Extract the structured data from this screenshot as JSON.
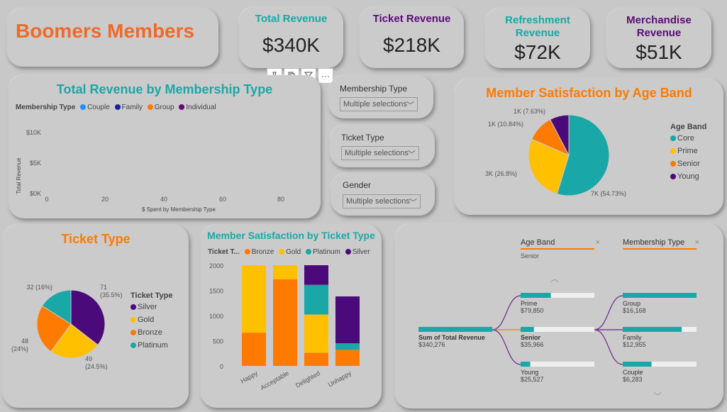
{
  "title": "Boomers Members",
  "kpis": [
    {
      "label": "Total Revenue",
      "value": "$340K",
      "color": "#1aa7a7"
    },
    {
      "label": "Ticket Revenue",
      "value": "$218K",
      "color": "#5b0a7a"
    },
    {
      "label": "Refreshment Revenue",
      "value": "$72K",
      "color": "#1aa7a7"
    },
    {
      "label": "Merchandise Revenue",
      "value": "$51K",
      "color": "#5b0a7a"
    }
  ],
  "toolbar": {
    "more": "···"
  },
  "colors": {
    "teal": "#1aa7a7",
    "purple": "#4b0a7a",
    "orange": "#ff7a00",
    "gold": "#ffc000",
    "title_orange": "#ee6a2a",
    "blue_light": "#1e90ff",
    "navy": "#12239e",
    "violet": "#6b007b"
  },
  "slicers": [
    {
      "label": "Membership Type",
      "value": "Multiple selections"
    },
    {
      "label": "Ticket Type",
      "value": "Multiple selections"
    },
    {
      "label": "Gender",
      "value": "Multiple selections"
    }
  ],
  "revenue_by_membership": {
    "title": "Total Revenue by Membership Type",
    "legend_title": "Membership Type",
    "legend": [
      "Couple",
      "Family",
      "Group",
      "Individual"
    ],
    "ylabel": "Total Revenue",
    "xlabel": "$ Spent by Membership Type",
    "yticks": [
      "$10K",
      "$5K",
      "$0K"
    ],
    "xticks": [
      "0",
      "20",
      "40",
      "60",
      "80"
    ]
  },
  "chart_data": [
    {
      "type": "pie",
      "title": "Member Satisfaction by Age Band",
      "legend_title": "Age Band",
      "labels": [
        "Core",
        "Prime",
        "Senior",
        "Young"
      ],
      "values": [
        54.73,
        26.8,
        10.84,
        7.63
      ],
      "data_labels": [
        "7K (54.73%)",
        "3K (26.8%)",
        "1K (10.84%)",
        "1K (7.63%)"
      ],
      "colors": [
        "#1aa7a7",
        "#ffc000",
        "#ff7a00",
        "#4b0a7a"
      ]
    },
    {
      "type": "pie",
      "title": "Ticket Type",
      "legend_title": "Ticket Type",
      "labels": [
        "Silver",
        "Gold",
        "Bronze",
        "Platinum"
      ],
      "values": [
        71,
        49,
        48,
        32
      ],
      "data_labels": [
        "71\n(35.5%)",
        "49\n(24.5%)",
        "48\n(24%)",
        "32 (16%)"
      ],
      "colors": [
        "#4b0a7a",
        "#ffc000",
        "#ff7a00",
        "#1aa7a7"
      ]
    },
    {
      "type": "bar",
      "stacked": true,
      "title": "Member Satisfaction by Ticket Type",
      "legend_title": "Ticket T...",
      "categories": [
        "Happy",
        "Acceptable",
        "Delighted",
        "Unhappy"
      ],
      "series": [
        {
          "name": "Bronze",
          "values": [
            660,
            1720,
            260,
            320
          ],
          "color": "#ff7a00"
        },
        {
          "name": "Gold",
          "values": [
            1340,
            280,
            760,
            0
          ],
          "color": "#ffc000"
        },
        {
          "name": "Platinum",
          "values": [
            0,
            0,
            590,
            130
          ],
          "color": "#1aa7a7"
        },
        {
          "name": "Silver",
          "values": [
            0,
            0,
            390,
            930
          ],
          "color": "#4b0a7a"
        }
      ],
      "yticks": [
        "2000",
        "1500",
        "1000",
        "500",
        "0"
      ],
      "ylim": [
        0,
        2000
      ]
    }
  ],
  "decomp": {
    "levels": [
      {
        "label": "Age Band",
        "selection": "Senior"
      },
      {
        "label": "Membership Type"
      }
    ],
    "root": {
      "label": "Sum of Total Revenue",
      "value": "$340,276",
      "fraction": 1.0
    },
    "age": [
      {
        "label": "Prime",
        "value": "$79,850",
        "fraction": 0.41
      },
      {
        "label": "Senior",
        "value": "$35,966",
        "fraction": 0.18
      },
      {
        "label": "Young",
        "value": "$25,527",
        "fraction": 0.13
      }
    ],
    "membership": [
      {
        "label": "Group",
        "value": "$16,168",
        "fraction": 1.0
      },
      {
        "label": "Family",
        "value": "$12,955",
        "fraction": 0.8
      },
      {
        "label": "Couple",
        "value": "$6,283",
        "fraction": 0.39
      }
    ]
  }
}
